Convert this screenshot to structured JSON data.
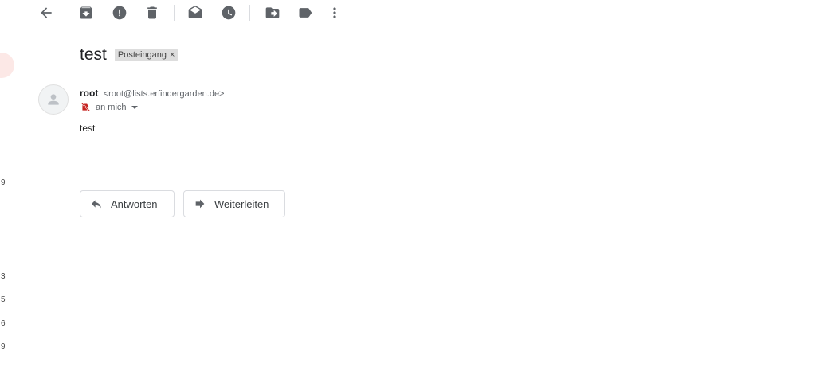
{
  "left_strip": {
    "numbers": [
      "9",
      "3",
      "5",
      "6",
      "9"
    ]
  },
  "message": {
    "subject": "test",
    "label": "Posteingang",
    "label_remove": "×",
    "sender_name": "root",
    "sender_email": "<root@lists.erfindergarden.de>",
    "recipient": "an mich",
    "body": "test"
  },
  "actions": {
    "reply_label": "Antworten",
    "forward_label": "Weiterleiten"
  },
  "colors": {
    "icon": "#5f6368",
    "divider": "#dadce0",
    "label_chip": "#dddddd"
  }
}
